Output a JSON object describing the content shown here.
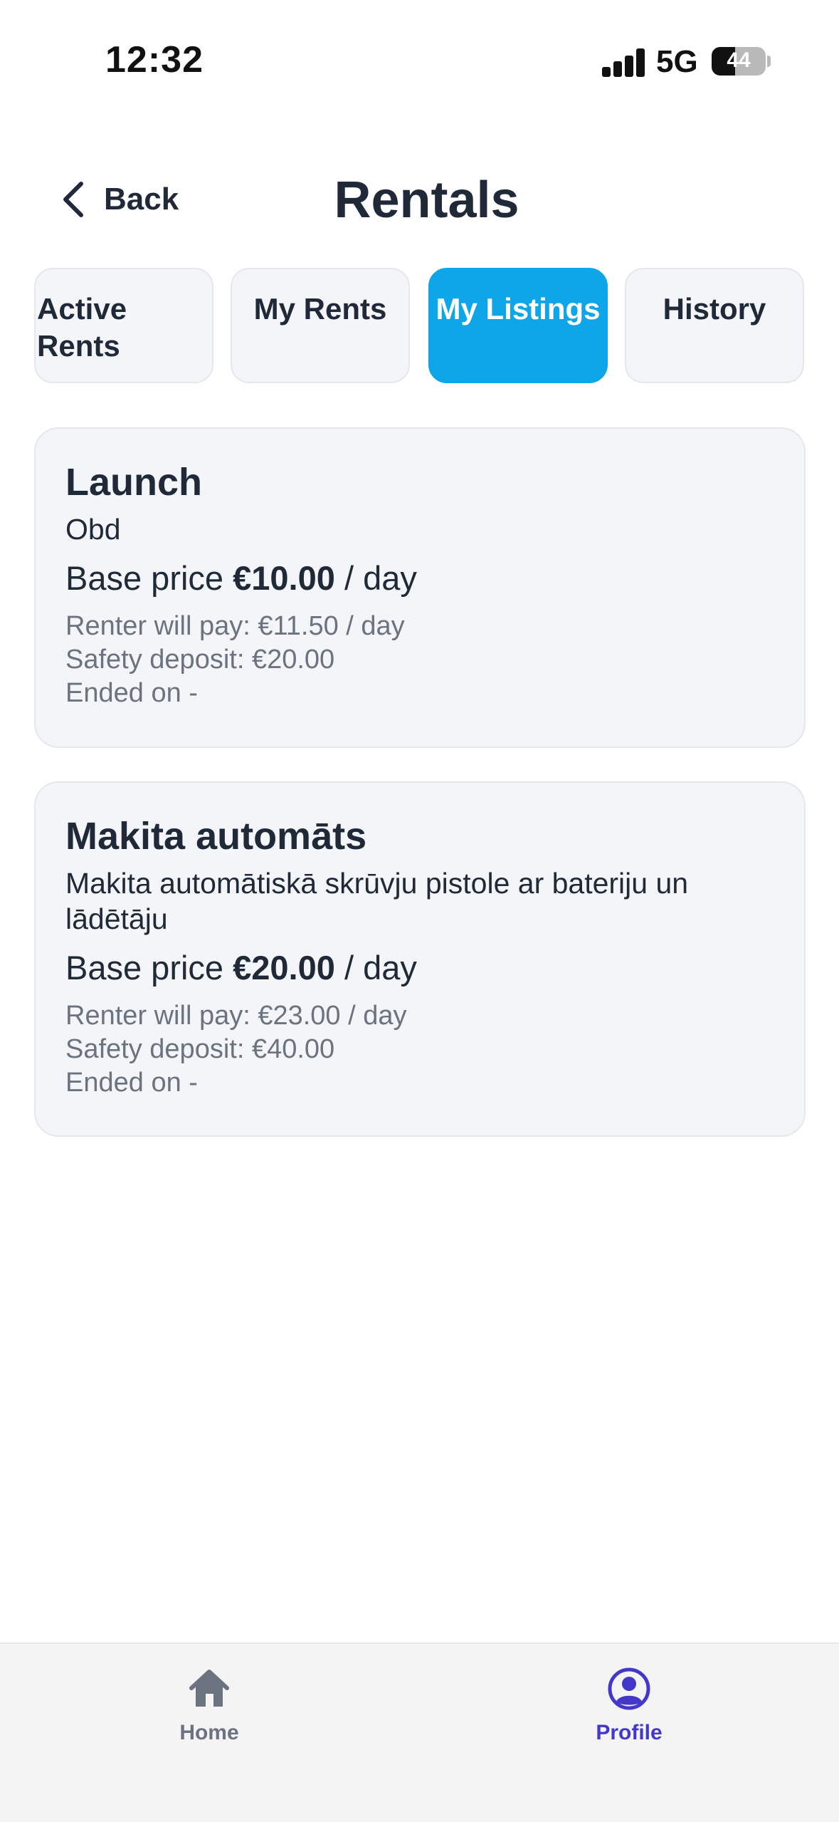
{
  "status_bar": {
    "time": "12:32",
    "network": "5G",
    "battery": "44",
    "battery_level": 0.44
  },
  "header": {
    "back_label": "Back",
    "title": "Rentals"
  },
  "tabs": [
    {
      "label": "Active Rents",
      "active": false
    },
    {
      "label": "My Rents",
      "active": false
    },
    {
      "label": "My Listings",
      "active": true
    },
    {
      "label": "History",
      "active": false
    }
  ],
  "listings": [
    {
      "title": "Launch",
      "description": "Obd",
      "price_prefix": "Base price",
      "price": "€10.00",
      "price_suffix": "/ day",
      "renter_pays": "Renter will pay: €11.50 / day",
      "deposit": "Safety deposit: €20.00",
      "ended": "Ended on -"
    },
    {
      "title": "Makita automāts",
      "description": "Makita automātiskā skrūvju pistole ar bateriju un lādētāju",
      "price_prefix": "Base price",
      "price": "€20.00",
      "price_suffix": "/ day",
      "renter_pays": "Renter will pay: €23.00 / day",
      "deposit": "Safety deposit: €40.00",
      "ended": "Ended on -"
    }
  ],
  "bottom_nav": [
    {
      "label": "Home",
      "icon": "home-icon",
      "color": "#6b7280",
      "active": false
    },
    {
      "label": "Profile",
      "icon": "profile-icon",
      "color": "#4338ca",
      "active": true
    }
  ],
  "colors": {
    "accent": "#0ea5e9",
    "text": "#1f2937",
    "muted": "#6b7280",
    "active_nav": "#4338ca"
  }
}
